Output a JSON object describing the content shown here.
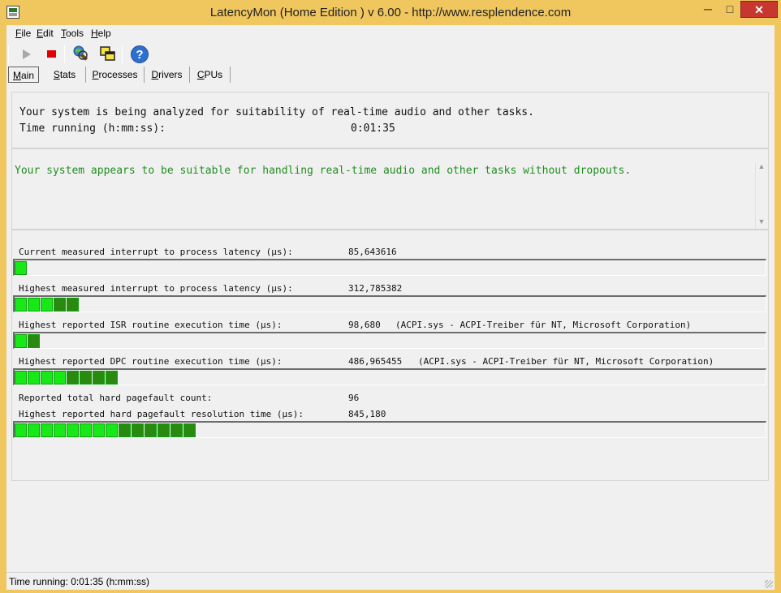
{
  "window": {
    "title": "LatencyMon  (Home Edition )  v 6.00 - http://www.resplendence.com",
    "minimize": "─",
    "maximize": "□",
    "close": "✕"
  },
  "menu": {
    "items": [
      {
        "label": "File",
        "key": "F",
        "rest": "ile"
      },
      {
        "label": "Edit",
        "key": "E",
        "rest": "dit"
      },
      {
        "label": "Tools",
        "key": "T",
        "rest": "ools"
      },
      {
        "label": "Help",
        "key": "H",
        "rest": "elp"
      }
    ]
  },
  "toolbar": {
    "icons": [
      "play-icon",
      "stop-icon",
      "globe-search-icon",
      "windows-icon",
      "help-icon"
    ],
    "help_glyph": "?"
  },
  "tabs": [
    {
      "label": "Main",
      "key": "M",
      "rest": "ain"
    },
    {
      "label": "Stats",
      "key": "S",
      "rest": "tats"
    },
    {
      "label": "Processes",
      "key": "P",
      "rest": "rocesses"
    },
    {
      "label": "Drivers",
      "key": "D",
      "rest": "rivers"
    },
    {
      "label": "CPUs",
      "key": "C",
      "rest": "PUs"
    }
  ],
  "status": {
    "line1": "Your system is being analyzed for suitability of real-time audio and other tasks.",
    "time_label": "Time running (h:mm:ss):",
    "time_value": "0:01:35"
  },
  "result": {
    "text": "Your system appears to be suitable for handling real-time audio and other tasks without dropouts.",
    "color": "#1f8e1f"
  },
  "metrics": [
    {
      "label": "Current measured interrupt to process latency (µs):",
      "value": "85,643616",
      "detail": "",
      "segments": 1
    },
    {
      "label": "Highest measured interrupt to process latency (µs):",
      "value": "312,785382",
      "detail": "",
      "segments": 5
    },
    {
      "label": "Highest reported ISR routine execution time (µs):",
      "value": "98,680",
      "detail": "(ACPI.sys - ACPI-Treiber für NT, Microsoft Corporation)",
      "segments": 2
    },
    {
      "label": "Highest reported DPC routine execution time (µs):",
      "value": "486,965455",
      "detail": "(ACPI.sys - ACPI-Treiber für NT, Microsoft Corporation)",
      "segments": 8
    },
    {
      "label": "Reported total hard pagefault count:",
      "value": "96",
      "detail": "",
      "segments": 0
    },
    {
      "label": "Highest reported hard pagefault resolution time (µs):",
      "value": "845,180",
      "detail": "",
      "segments": 14
    }
  ],
  "statusbar": {
    "text": "Time running: 0:01:35  (h:mm:ss)"
  },
  "colors": {
    "bar_green": "#18e818",
    "bar_dark_green": "#2a8a10",
    "titlebar": "#f0c75e"
  }
}
